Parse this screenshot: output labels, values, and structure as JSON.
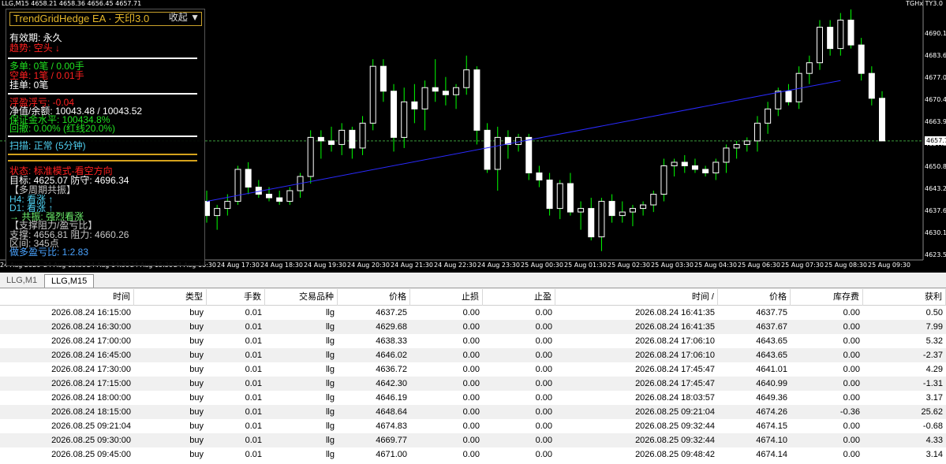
{
  "chart": {
    "header": "LLG,M15  4658.21 4658.36 4656.45 4657.71",
    "right_title": "TGHx TY3.0",
    "price_labels": [
      "4690.1",
      "4683.6",
      "4677.0",
      "4670.4",
      "4663.9",
      "4657.3",
      "4650.8",
      "4643.2",
      "4637.6",
      "4630.1",
      "4623.5"
    ],
    "current_price": "4657.7",
    "time_labels": [
      "24 Aug 2026",
      "24 Aug 13:30",
      "24 Aug 14:30",
      "24 Aug 15:30",
      "24 Aug 16:30",
      "24 Aug 17:30",
      "24 Aug 18:30",
      "24 Aug 19:30",
      "24 Aug 20:30",
      "24 Aug 21:30",
      "24 Aug 22:30",
      "24 Aug 23:30",
      "25 Aug 00:30",
      "25 Aug 01:30",
      "25 Aug 02:30",
      "25 Aug 03:30",
      "25 Aug 04:30",
      "25 Aug 06:30",
      "25 Aug 07:30",
      "25 Aug 08:30",
      "25 Aug 09:30"
    ],
    "colors": {
      "background": "#000000",
      "candle_up": "#ffffff",
      "candle_down": "#ffffff",
      "wick": "#00ff00",
      "trend_line": "#2a2aff"
    }
  },
  "chart_data": {
    "type": "candlestick",
    "y_range": [
      4623.5,
      4694.0
    ],
    "candles": [
      [
        4640,
        4643,
        4634,
        4636
      ],
      [
        4636,
        4639,
        4632,
        4638
      ],
      [
        4638,
        4642,
        4636,
        4640
      ],
      [
        4640,
        4650,
        4639,
        4649
      ],
      [
        4649,
        4651,
        4642,
        4644
      ],
      [
        4644,
        4646,
        4641,
        4642
      ],
      [
        4642,
        4644,
        4640,
        4641
      ],
      [
        4641,
        4643,
        4639,
        4640
      ],
      [
        4640,
        4644,
        4639,
        4643
      ],
      [
        4643,
        4648,
        4641,
        4647
      ],
      [
        4647,
        4660,
        4645,
        4658
      ],
      [
        4658,
        4660,
        4652,
        4657
      ],
      [
        4657,
        4661,
        4654,
        4656
      ],
      [
        4656,
        4662,
        4653,
        4660
      ],
      [
        4660,
        4661,
        4652,
        4655
      ],
      [
        4655,
        4664,
        4653,
        4662
      ],
      [
        4662,
        4680,
        4660,
        4678
      ],
      [
        4678,
        4680,
        4668,
        4671
      ],
      [
        4671,
        4673,
        4654,
        4658
      ],
      [
        4658,
        4672,
        4655,
        4668
      ],
      [
        4668,
        4673,
        4662,
        4666
      ],
      [
        4666,
        4674,
        4660,
        4672
      ],
      [
        4672,
        4680,
        4668,
        4671
      ],
      [
        4671,
        4675,
        4667,
        4670
      ],
      [
        4670,
        4673,
        4666,
        4672
      ],
      [
        4672,
        4681,
        4670,
        4677
      ],
      [
        4677,
        4678,
        4656,
        4660
      ],
      [
        4660,
        4662,
        4648,
        4649
      ],
      [
        4649,
        4661,
        4643,
        4658
      ],
      [
        4658,
        4660,
        4652,
        4656
      ],
      [
        4656,
        4659,
        4654,
        4658
      ],
      [
        4658,
        4659,
        4646,
        4648
      ],
      [
        4648,
        4650,
        4644,
        4646
      ],
      [
        4646,
        4648,
        4636,
        4638
      ],
      [
        4638,
        4646,
        4635,
        4645
      ],
      [
        4645,
        4648,
        4636,
        4637
      ],
      [
        4637,
        4640,
        4632,
        4638
      ],
      [
        4638,
        4641,
        4629,
        4630
      ],
      [
        4630,
        4641,
        4626,
        4640
      ],
      [
        4640,
        4642,
        4634,
        4636
      ],
      [
        4636,
        4640,
        4634,
        4637
      ],
      [
        4637,
        4639,
        4633,
        4638
      ],
      [
        4638,
        4640,
        4636,
        4639
      ],
      [
        4639,
        4643,
        4637,
        4642
      ],
      [
        4642,
        4652,
        4640,
        4650
      ],
      [
        4650,
        4652,
        4647,
        4651
      ],
      [
        4651,
        4653,
        4648,
        4650
      ],
      [
        4650,
        4652,
        4648,
        4649
      ],
      [
        4649,
        4650,
        4647,
        4648
      ],
      [
        4648,
        4652,
        4646,
        4651
      ],
      [
        4651,
        4656,
        4648,
        4655
      ],
      [
        4655,
        4657,
        4652,
        4656
      ],
      [
        4656,
        4658,
        4654,
        4657
      ],
      [
        4657,
        4664,
        4654,
        4662
      ],
      [
        4662,
        4668,
        4659,
        4666
      ],
      [
        4666,
        4672,
        4664,
        4671
      ],
      [
        4671,
        4673,
        4667,
        4668
      ],
      [
        4668,
        4678,
        4666,
        4676
      ],
      [
        4676,
        4681,
        4673,
        4679
      ],
      [
        4679,
        4691,
        4677,
        4689
      ],
      [
        4689,
        4691,
        4681,
        4683
      ],
      [
        4683,
        4693,
        4681,
        4691
      ],
      [
        4691,
        4694,
        4683,
        4684
      ],
      [
        4684,
        4686,
        4674,
        4676
      ],
      [
        4676,
        4678,
        4667,
        4669
      ],
      [
        4669,
        4671,
        4659,
        4657
      ]
    ],
    "trend_line": [
      [
        4640,
        4640
      ],
      [
        4674,
        4674
      ]
    ]
  },
  "panel": {
    "title": "TrendGridHedge EA · 天印3.0",
    "collapse_label": "收起 ▼",
    "validity": "有效期: 永久",
    "trend": "趋势: 空头 ↓",
    "long": "多单: 0笔 / 0.00手",
    "short": "空单: 1笔 / 0.01手",
    "pending": "挂单: 0笔",
    "floating": "浮盈浮亏: -0.04",
    "equity": "净值/余额: 10043.48 / 10043.52",
    "margin_level": "保证金水平: 100434.8%",
    "drawdown": "回撤: 0.00% (红线20.0%)",
    "scan": "扫描: 正常 (5分钟)",
    "status": "状态: 标准模式-看空方向",
    "target": "目标: 4625.07  防守: 4696.34",
    "multi_cycle": "【多周期共振】",
    "h4": "H4: 看涨 ↑",
    "d1": "D1: 看涨 ↑",
    "resonance": "→ 共振: 强烈看涨",
    "sr_title": "【支撑阻力/盈亏比】",
    "sr": "支撑: 4656.81  阻力: 4660.26",
    "range": "区间: 345点",
    "rr": "做多盈亏比: 1:2.83"
  },
  "tabs": [
    {
      "label": "LLG,M1",
      "active": false
    },
    {
      "label": "LLG,M15",
      "active": true
    }
  ],
  "table": {
    "headers": [
      "时间",
      "类型",
      "手数",
      "交易品种",
      "价格",
      "止损",
      "止盈",
      "时间  /",
      "价格",
      "库存费",
      "获利"
    ],
    "rows": [
      [
        "2026.08.24 16:15:00",
        "buy",
        "0.01",
        "llg",
        "4637.25",
        "0.00",
        "0.00",
        "2026.08.24 16:41:35",
        "4637.75",
        "0.00",
        "0.50"
      ],
      [
        "2026.08.24 16:30:00",
        "buy",
        "0.01",
        "llg",
        "4629.68",
        "0.00",
        "0.00",
        "2026.08.24 16:41:35",
        "4637.67",
        "0.00",
        "7.99"
      ],
      [
        "2026.08.24 17:00:00",
        "buy",
        "0.01",
        "llg",
        "4638.33",
        "0.00",
        "0.00",
        "2026.08.24 17:06:10",
        "4643.65",
        "0.00",
        "5.32"
      ],
      [
        "2026.08.24 16:45:00",
        "buy",
        "0.01",
        "llg",
        "4646.02",
        "0.00",
        "0.00",
        "2026.08.24 17:06:10",
        "4643.65",
        "0.00",
        "-2.37"
      ],
      [
        "2026.08.24 17:30:00",
        "buy",
        "0.01",
        "llg",
        "4636.72",
        "0.00",
        "0.00",
        "2026.08.24 17:45:47",
        "4641.01",
        "0.00",
        "4.29"
      ],
      [
        "2026.08.24 17:15:00",
        "buy",
        "0.01",
        "llg",
        "4642.30",
        "0.00",
        "0.00",
        "2026.08.24 17:45:47",
        "4640.99",
        "0.00",
        "-1.31"
      ],
      [
        "2026.08.24 18:00:00",
        "buy",
        "0.01",
        "llg",
        "4646.19",
        "0.00",
        "0.00",
        "2026.08.24 18:03:57",
        "4649.36",
        "0.00",
        "3.17"
      ],
      [
        "2026.08.24 18:15:00",
        "buy",
        "0.01",
        "llg",
        "4648.64",
        "0.00",
        "0.00",
        "2026.08.25 09:21:04",
        "4674.26",
        "-0.36",
        "25.62"
      ],
      [
        "2026.08.25 09:21:04",
        "buy",
        "0.01",
        "llg",
        "4674.83",
        "0.00",
        "0.00",
        "2026.08.25 09:32:44",
        "4674.15",
        "0.00",
        "-0.68"
      ],
      [
        "2026.08.25 09:30:00",
        "buy",
        "0.01",
        "llg",
        "4669.77",
        "0.00",
        "0.00",
        "2026.08.25 09:32:44",
        "4674.10",
        "0.00",
        "4.33"
      ],
      [
        "2026.08.25 09:45:00",
        "buy",
        "0.01",
        "llg",
        "4671.00",
        "0.00",
        "0.00",
        "2026.08.25 09:48:42",
        "4674.14",
        "0.00",
        "3.14"
      ]
    ]
  }
}
